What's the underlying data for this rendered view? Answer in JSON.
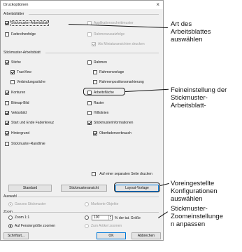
{
  "dialog": {
    "title": "Druckoptionen",
    "close": "×"
  },
  "arbeitsblatter": {
    "heading": "Arbeitsblätter",
    "stickmuster": "Stickmuster-Arbeitsblatt",
    "applikation": "Applikationsschnittmuster",
    "farbreihenfolge": "Farbreihenfolge",
    "rahmen": "Rahmenzusatzfolge",
    "miniatur": "Als Miniaturansichten drucken"
  },
  "stickmuster_arbeitsblatt": {
    "heading": "Stickmuster-Arbeitsblatt",
    "left": [
      {
        "label": "Stiche",
        "checked": true
      },
      {
        "label": "TrueView",
        "checked": true,
        "indent": true
      },
      {
        "label": "Verbindungsstiche",
        "checked": false,
        "indent": true
      },
      {
        "label": "Konturen",
        "checked": true
      },
      {
        "label": "Bitmap-Bild",
        "checked": false
      },
      {
        "label": "Vektorbild",
        "checked": true
      },
      {
        "label": "Start und Ende Fadenkreuz",
        "checked": true
      },
      {
        "label": "Hintergrund",
        "checked": true
      },
      {
        "label": "Stickmuster-Randlinie",
        "checked": false
      }
    ],
    "right": [
      {
        "label": "Rahmen",
        "checked": false
      },
      {
        "label": "Rahmenvorlage",
        "checked": false,
        "indent": true
      },
      {
        "label": "Rahmenpositionsmarkierung",
        "checked": false,
        "indent": true
      },
      {
        "label": "Arbeitsfläche",
        "checked": false
      },
      {
        "label": "Raster",
        "checked": false
      },
      {
        "label": "Hilfslinien",
        "checked": false
      },
      {
        "label": "Stickmusterinformationen",
        "checked": true
      },
      {
        "label": "Oberfadenverbrauch",
        "checked": true,
        "indent": true
      }
    ],
    "separate_page": "Auf einer separaten Seite drucken"
  },
  "preset_buttons": {
    "standard": "Standard",
    "stickmusteransicht": "Stickmusteransicht",
    "layout": "Layout-Vorlage"
  },
  "auswahl": {
    "heading": "Auswahl",
    "ganzes": "Ganzes Stickmuster",
    "markierte": "Markierte Objekte"
  },
  "zoom": {
    "heading": "Zoom",
    "zoom11": "Zoom 1:1",
    "fenster": "Auf Fenstergröße zoomen",
    "value": "100",
    "suffix": "% der tat. Größe",
    "artikel": "Zum Artikel zoomen"
  },
  "footer": {
    "schriftart": "Schriftart...",
    "ok": "OK",
    "abbrechen": "Abbrechen"
  },
  "annotations": {
    "art": [
      "Art des",
      "Arbeitsblattes",
      "auswählen"
    ],
    "fein": [
      "Feineinstellung der",
      "Stickmuster-",
      "Arbeitsblatt-"
    ],
    "vorein": [
      "Voreingestellte",
      "Konfigurationen",
      "auswählen"
    ],
    "zoom": [
      "Stickmuster-",
      "Zoomeinstellunge",
      "n anpassen"
    ]
  }
}
